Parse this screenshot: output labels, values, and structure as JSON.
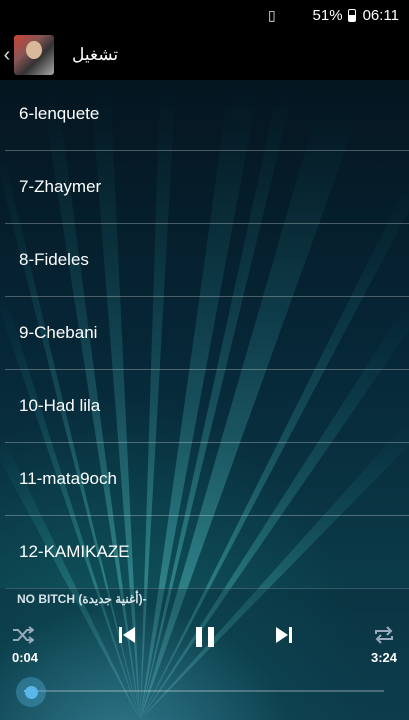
{
  "status_bar": {
    "battery": "51%",
    "time": "06:11"
  },
  "app_bar": {
    "title": "تشغيل"
  },
  "playlist": [
    "6-lenquete",
    "7-Zhaymer",
    "8-Fideles",
    "9-Chebani",
    "10-Had lila",
    "11-mata9och",
    "12-KAMIKAZE"
  ],
  "player": {
    "now_playing": "NO BITCH (أغنية جديدة)-",
    "elapsed": "0:04",
    "duration": "3:24",
    "progress": 0.02
  },
  "colors": {
    "accent": "#5ab8e8",
    "bar": "#000000"
  }
}
